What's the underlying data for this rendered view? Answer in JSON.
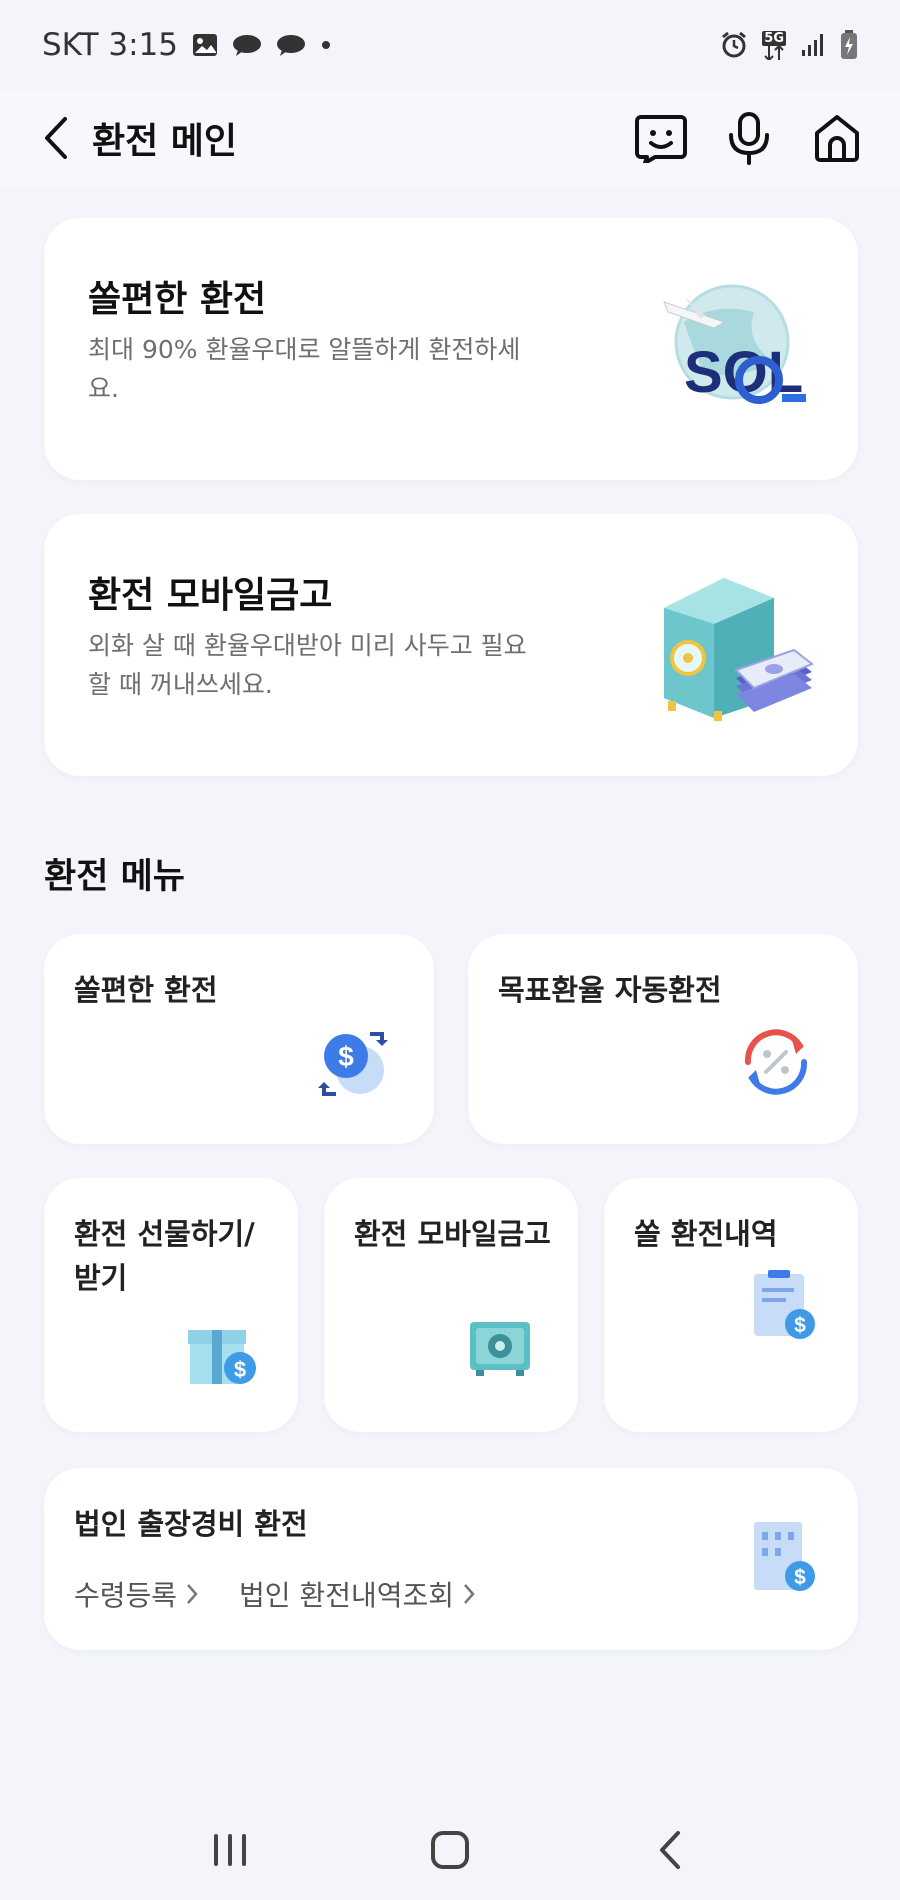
{
  "status": {
    "carrier_time": "SKT 3:15",
    "network": "5G"
  },
  "header": {
    "title": "환전 메인"
  },
  "promo_cards": [
    {
      "title": "쏠편한 환전",
      "desc": "최대 90% 환율우대로 알뜰하게 환전하세요.",
      "art_text": "SOL"
    },
    {
      "title": "환전 모바일금고",
      "desc": "외화 살 때 환율우대받아 미리 사두고 필요할 때 꺼내쓰세요."
    }
  ],
  "menu_section": {
    "title": "환전 메뉴",
    "items": [
      {
        "label": "쏠편한 환전",
        "icon": "dollar-exchange-icon"
      },
      {
        "label": "목표환율 자동환전",
        "icon": "percent-cycle-icon"
      },
      {
        "label": "환전 선물하기/받기",
        "icon": "gift-dollar-icon"
      },
      {
        "label": "환전 모바일금고",
        "icon": "safe-icon"
      },
      {
        "label": "쏠 환전내역",
        "icon": "receipt-dollar-icon"
      }
    ],
    "corporate": {
      "label": "법인 출장경비 환전",
      "links": [
        "수령등록",
        "법인 환전내역조회"
      ],
      "icon": "building-dollar-icon"
    }
  },
  "colors": {
    "background": "#f3f5fa",
    "card": "#ffffff",
    "accent_blue": "#3f7be8",
    "teal": "#5bc0c6"
  }
}
